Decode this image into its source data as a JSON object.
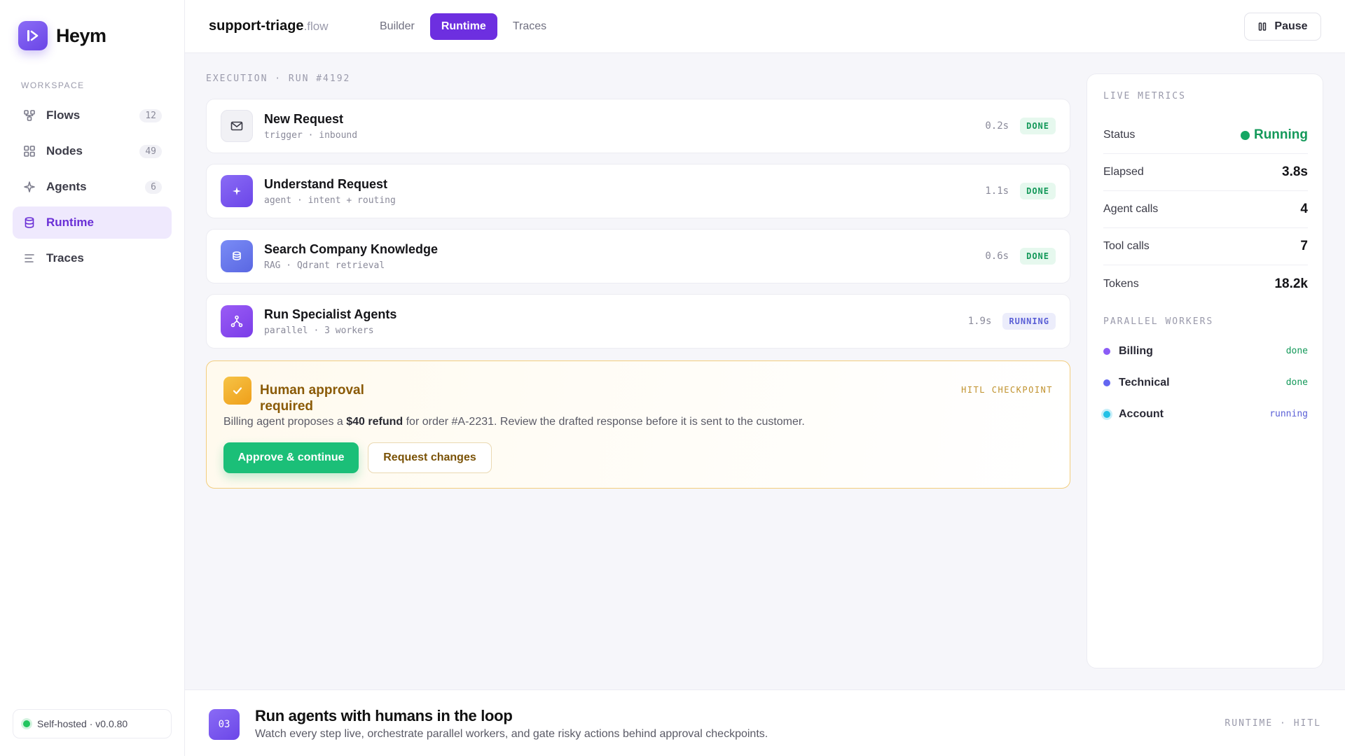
{
  "brand": {
    "name": "Heym"
  },
  "sidebar": {
    "section_label": "WORKSPACE",
    "items": [
      {
        "label": "Flows",
        "count": "12",
        "icon": "flows-icon"
      },
      {
        "label": "Nodes",
        "count": "49",
        "icon": "grid-icon"
      },
      {
        "label": "Agents",
        "count": "6",
        "icon": "sparkle-icon"
      },
      {
        "label": "Runtime",
        "count": "",
        "icon": "database-icon",
        "active": true
      },
      {
        "label": "Traces",
        "count": "",
        "icon": "list-icon"
      }
    ],
    "footer": "Self-hosted · v0.0.80"
  },
  "header": {
    "flow_name": "support-triage",
    "flow_ext": ".flow",
    "tabs": [
      {
        "label": "Builder"
      },
      {
        "label": "Runtime",
        "active": true
      },
      {
        "label": "Traces"
      }
    ],
    "pause_label": "Pause"
  },
  "execution": {
    "label": "EXECUTION · RUN #4192",
    "steps": [
      {
        "title": "New Request",
        "sub": "trigger · inbound",
        "time": "0.2s",
        "status": "DONE",
        "icon": "mail-icon"
      },
      {
        "title": "Understand Request",
        "sub": "agent · intent + routing",
        "time": "1.1s",
        "status": "DONE",
        "icon": "sparkle-icon"
      },
      {
        "title": "Search Company Knowledge",
        "sub": "RAG · Qdrant retrieval",
        "time": "0.6s",
        "status": "DONE",
        "icon": "database-icon"
      },
      {
        "title": "Run Specialist Agents",
        "sub": "parallel · 3 workers",
        "time": "1.9s",
        "status": "RUNNING",
        "icon": "branch-icon"
      }
    ]
  },
  "hitl": {
    "title": "Human approval required",
    "tag": "HITL CHECKPOINT",
    "desc_pre": "Billing agent proposes a ",
    "desc_bold": "$40 refund",
    "desc_post": " for order #A-2231. Review the drafted response before it is sent to the customer.",
    "approve_label": "Approve & continue",
    "changes_label": "Request changes"
  },
  "metrics": {
    "label": "LIVE METRICS",
    "rows": [
      {
        "key": "Status",
        "value": "Running"
      },
      {
        "key": "Elapsed",
        "value": "3.8s"
      },
      {
        "key": "Agent calls",
        "value": "4"
      },
      {
        "key": "Tool calls",
        "value": "7"
      },
      {
        "key": "Tokens",
        "value": "18.2k"
      }
    ],
    "workers_label": "PARALLEL WORKERS",
    "workers": [
      {
        "name": "Billing",
        "status": "done",
        "color": "#8b5cf6"
      },
      {
        "name": "Technical",
        "status": "done",
        "color": "#6366f1"
      },
      {
        "name": "Account",
        "status": "running",
        "color": "#22c1e6"
      }
    ]
  },
  "feature": {
    "number": "03",
    "title": "Run agents with humans in the loop",
    "subtitle": "Watch every step live, orchestrate parallel workers, and gate risky actions behind approval checkpoints.",
    "tag": "RUNTIME · HITL"
  },
  "colors": {
    "accent": "#6d2fe0",
    "success": "#14995a",
    "warning": "#f2cd7e"
  }
}
